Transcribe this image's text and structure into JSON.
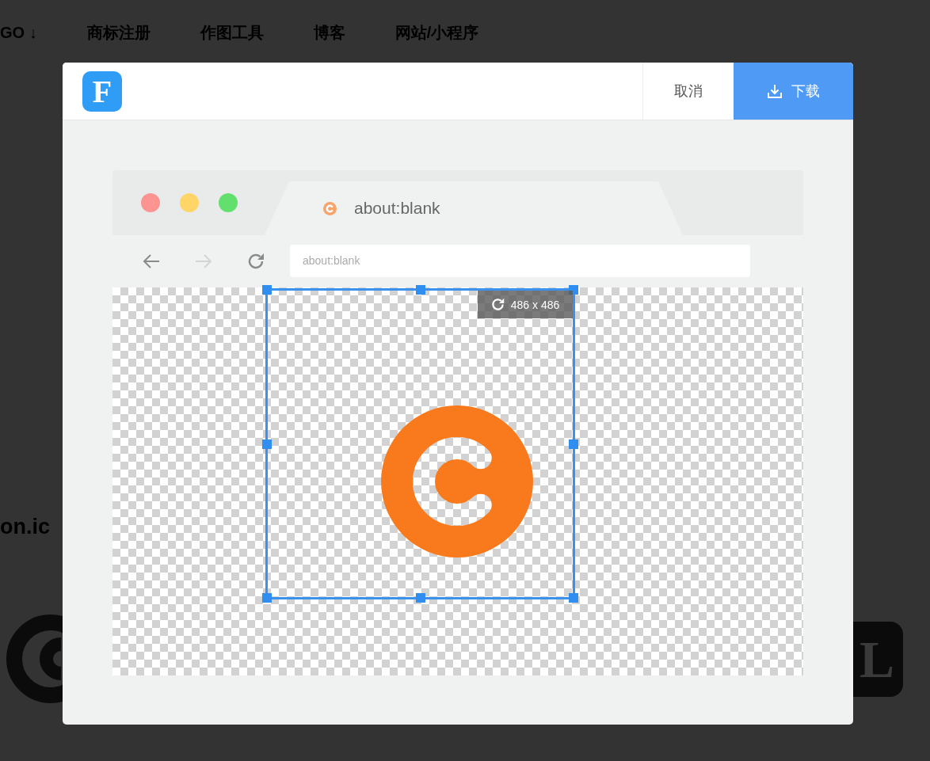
{
  "background_nav": {
    "items": [
      "GO ↓",
      "商标注册",
      "作图工具",
      "博客",
      "网站/小程序"
    ]
  },
  "background_text": "on.ic",
  "background_logo": {
    "letter": "L"
  },
  "dialog": {
    "logo_letter": "F",
    "buttons": [
      {
        "kind": "cancel",
        "label": "取消"
      },
      {
        "kind": "download",
        "label": "下载"
      }
    ]
  },
  "browser": {
    "tab_title": "about:blank",
    "address": "about:blank",
    "nav_buttons": [
      {
        "kind": "back",
        "disabled": false
      },
      {
        "kind": "forward",
        "disabled": true
      },
      {
        "kind": "reload",
        "disabled": false
      }
    ]
  },
  "selection": {
    "size_label": "486 x 486"
  }
}
